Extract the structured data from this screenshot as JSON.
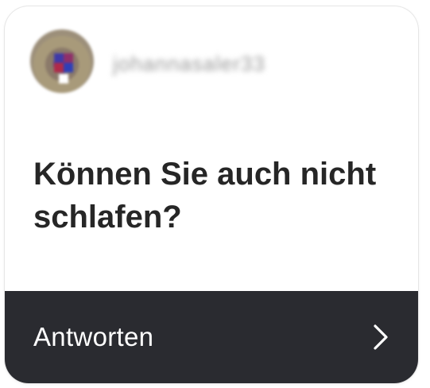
{
  "card": {
    "username": "johannasaler33",
    "question": "Können Sie auch nicht schlafen?",
    "reply_label": "Antworten"
  },
  "icons": {
    "avatar": "profile-avatar",
    "chevron": "chevron-right-icon"
  },
  "colors": {
    "footer_bg": "#2a2b30",
    "question_text": "#262626",
    "footer_text": "#ffffff"
  }
}
